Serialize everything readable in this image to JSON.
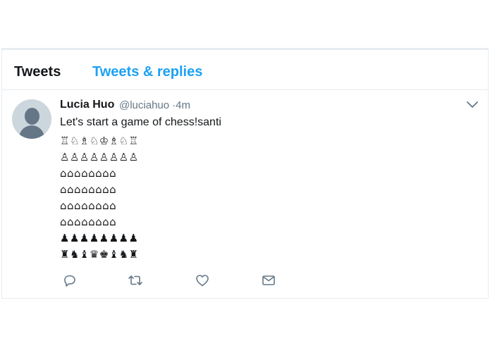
{
  "tabs": [
    {
      "label": "Tweets"
    },
    {
      "label": "Tweets & replies"
    }
  ],
  "tweet": {
    "name": "Lucia Huo",
    "handle": "@luciahuo",
    "time": "4m",
    "separator": "·",
    "text": "Let's start a game of chess!santi",
    "board": [
      "♖♘♗♘♔♗♘♖",
      "♙♙♙♙♙♙♙♙",
      "⌂⌂⌂⌂⌂⌂⌂⌂",
      "⌂⌂⌂⌂⌂⌂⌂⌂",
      "⌂⌂⌂⌂⌂⌂⌂⌂",
      "⌂⌂⌂⌂⌂⌂⌂⌂",
      "♟♟♟♟♟♟♟♟",
      "♜♞♝♛♚♝♞♜"
    ]
  },
  "icons": {
    "caret": "chevron-down-icon",
    "reply": "reply-icon",
    "retweet": "retweet-icon",
    "like": "heart-icon",
    "dm": "envelope-icon"
  },
  "colors": {
    "accent": "#1da1f2",
    "text": "#14171a",
    "muted": "#657786",
    "border": "#e6ecf0"
  }
}
